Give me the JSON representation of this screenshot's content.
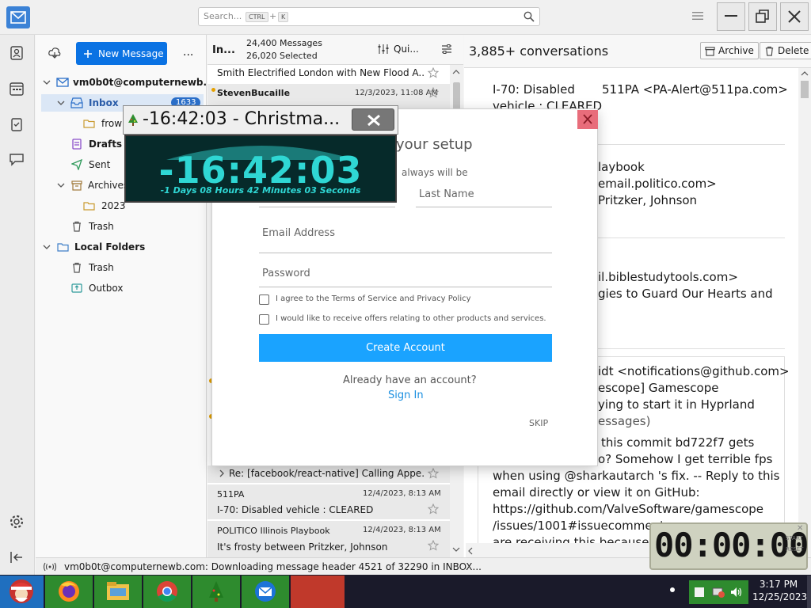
{
  "search": {
    "placeholder": "Search...",
    "key1": "CTRL",
    "plus": "+",
    "key2": "K"
  },
  "toolbar": {
    "new_message": "New Message",
    "more": "..."
  },
  "account": {
    "name": "vm0b0t@computernewb..."
  },
  "folders": [
    {
      "label": "Inbox",
      "badge": "1633"
    },
    {
      "label": "frown"
    },
    {
      "label": "Drafts"
    },
    {
      "label": "Sent"
    },
    {
      "label": "Archives"
    },
    {
      "label": "2023"
    },
    {
      "label": "Trash"
    },
    {
      "label": "Local Folders"
    },
    {
      "label": "Trash"
    },
    {
      "label": "Outbox"
    }
  ],
  "list_header": {
    "folder": "In...",
    "messages": "24,400 Messages",
    "selected": "26,020 Selected",
    "quick": "Qui..."
  },
  "messages": [
    {
      "subject": "Smith Electrified London with New Flood A..."
    },
    {
      "from": "StevenBucaille",
      "date": "12/3/2023, 11:08 AM"
    },
    {
      "subject": "Re: [facebook/react-native] Calling Appe..."
    },
    {
      "from": "511PA",
      "date": "12/4/2023, 8:13 AM",
      "subject": "I-70: Disabled vehicle : CLEARED"
    },
    {
      "from": "POLITICO Illinois Playbook",
      "date": "12/4/2023, 8:13 AM",
      "subject": "It's frosty between Pritzker, Johnson"
    }
  ],
  "reading": {
    "count": "3,885+ conversations",
    "archive": "Archive",
    "delete": "Delete",
    "lines": [
      "I-70: Disabled",
      "vehicle : CLEARED",
      "511PA <PA-Alert@511pa.com>",
      "laybook",
      "email.politico.com>",
      "Pritzker, Johnson",
      "il.biblestudytools.com>",
      "gies to Guard Our Hearts and",
      "idt <notifications@github.com>",
      "escope] Gamescope",
      "ying to start it in Hyprland",
      "essages)",
      "this commit bd722f7 gets",
      "o? Somehow I get terrible fps",
      "when using @sharkautarch 's fix. -- Reply to this",
      "email directly or view it on GitHub:",
      "https://github.com/ValveSoftware/gamescope",
      "/issues/1001#issuecomment-",
      "are receiving this because yo"
    ]
  },
  "signup": {
    "title": "your setup",
    "subtitle": "always will be",
    "last_name": "Last Name",
    "email": "Email Address",
    "password": "Password",
    "terms": "I agree to the Terms of Service and Privacy Policy",
    "offers": "I would like to receive offers relating to other products and services.",
    "create": "Create Account",
    "have_account": "Already have an account?",
    "sign_in": "Sign In",
    "skip": "SKIP"
  },
  "countdown": {
    "title": "-16:42:03 - Christma...",
    "time": "-16:42:03",
    "detail": "-1 Days 08 Hours 42 Minutes 03 Seconds"
  },
  "stopwatch": {
    "time": "00:00:00",
    "label1": "START",
    "label2": "RESET"
  },
  "status": {
    "text": "vm0b0t@computernewb.com: Downloading message header 4521 of 32290 in INBOX..."
  },
  "clock": {
    "time": "3:17 PM",
    "date": "12/25/2023"
  },
  "colors": {
    "accent": "#0a72e3",
    "create_button": "#1aa3ff",
    "countdown_text": "#2fd7d4",
    "taskbar_green": "#2e8b2e"
  }
}
